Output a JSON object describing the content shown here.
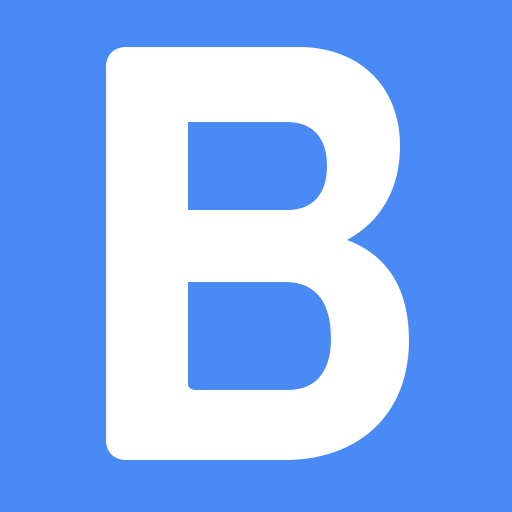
{
  "icon": {
    "letter": "B",
    "name": "letter-b-app-icon",
    "background_color": "#4a8af4",
    "letter_color": "#ffffff"
  }
}
